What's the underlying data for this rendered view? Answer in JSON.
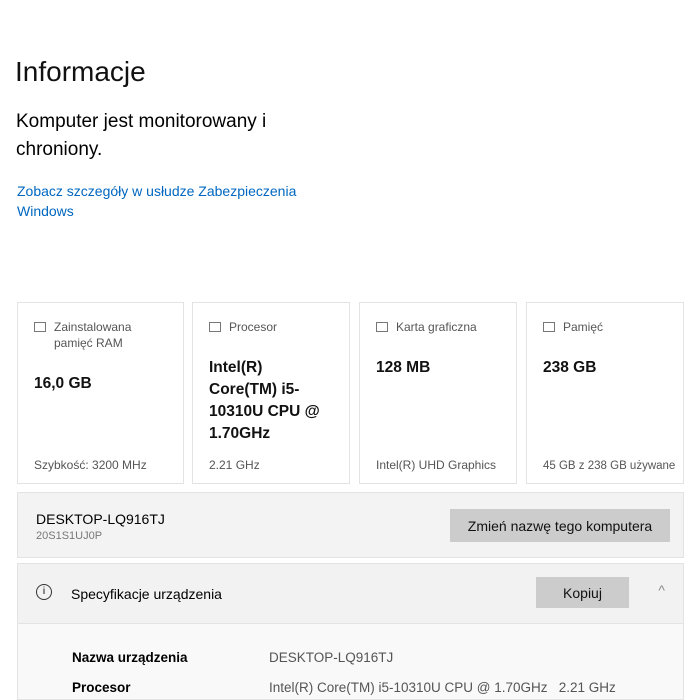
{
  "title": "Informacje",
  "status": "Komputer jest monitorowany i chroniony.",
  "security_link": "Zobacz szczegóły w usłudze Zabezpieczenia Windows",
  "cards": [
    {
      "icon": "ram-icon",
      "label": "Zainstalowana pamięć RAM",
      "value": "16,0 GB",
      "footer": "Szybkość: 3200 MHz"
    },
    {
      "icon": "processor-icon",
      "label": "Procesor",
      "value": "Intel(R) Core(TM) i5-10310U CPU @ 1.70GHz",
      "footer": "2.21 GHz"
    },
    {
      "icon": "graphics-card-icon",
      "label": "Karta graficzna",
      "value": "128 MB",
      "footer": "Intel(R) UHD Graphics"
    },
    {
      "icon": "storage-icon",
      "label": "Pamięć",
      "value": "238 GB",
      "footer": "45 GB z 238 GB używane"
    }
  ],
  "device": {
    "name": "DESKTOP-LQ916TJ",
    "model": "20S1S1UJ0P",
    "rename_label": "Zmień nazwę tego komputera"
  },
  "spec": {
    "title": "Specyfikacje urządzenia",
    "copy_label": "Kopiuj",
    "info_glyph": "i",
    "chevron": "^",
    "rows": [
      {
        "label": "Nazwa urządzenia",
        "value": "DESKTOP-LQ916TJ"
      },
      {
        "label": "Procesor",
        "value": "Intel(R) Core(TM) i5-10310U CPU @ 1.70GHz   2.21 GHz"
      }
    ]
  }
}
